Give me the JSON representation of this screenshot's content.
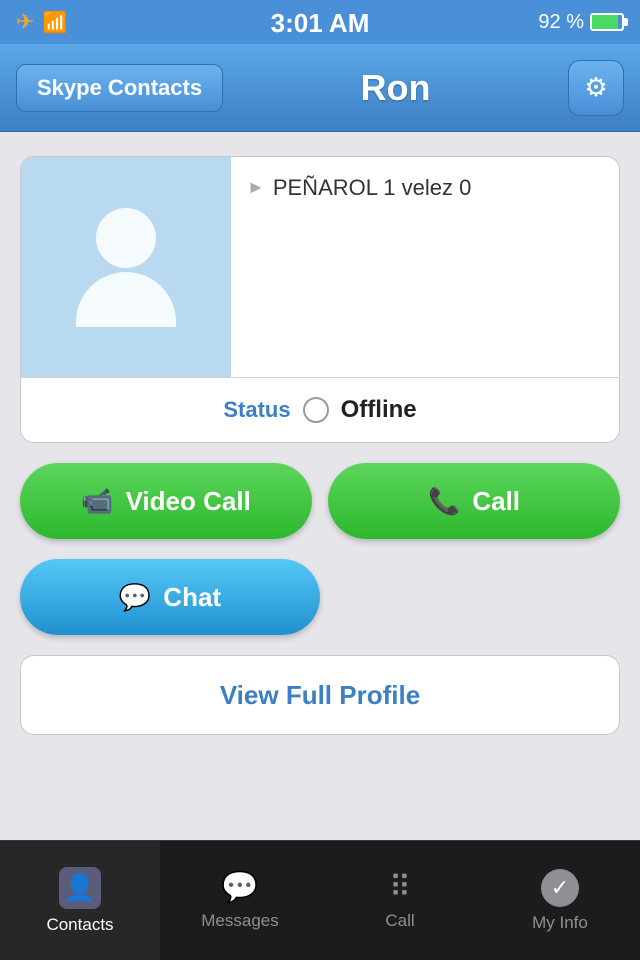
{
  "statusBar": {
    "time": "3:01 AM",
    "battery": "92 %"
  },
  "navBar": {
    "backLabel": "Skype Contacts",
    "title": "Ron",
    "settingsIcon": "⚙"
  },
  "profile": {
    "statusMessage": "PEÑAROL 1 velez 0",
    "statusLabel": "Status",
    "statusValue": "Offline"
  },
  "buttons": {
    "videoCall": "Video Call",
    "call": "Call",
    "chat": "Chat",
    "viewFullProfile": "View Full Profile"
  },
  "tabBar": {
    "items": [
      {
        "label": "Contacts",
        "active": true
      },
      {
        "label": "Messages",
        "active": false
      },
      {
        "label": "Call",
        "active": false
      },
      {
        "label": "My Info",
        "active": false
      }
    ]
  }
}
